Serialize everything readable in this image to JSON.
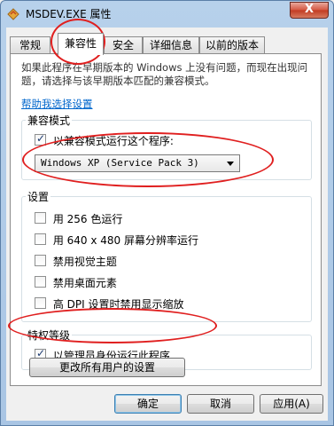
{
  "window": {
    "title": "MSDEV.EXE 属性",
    "close_label": "X"
  },
  "tabs": [
    {
      "label": "常规"
    },
    {
      "label": "兼容性"
    },
    {
      "label": "安全"
    },
    {
      "label": "详细信息"
    },
    {
      "label": "以前的版本"
    }
  ],
  "intro_text": "如果此程序在早期版本的 Windows 上没有问题，而现在出现问题，请选择与该早期版本匹配的兼容模式。",
  "help_link": "帮助我选择设置",
  "compat_mode": {
    "label": "兼容模式",
    "checkbox_label": "以兼容模式运行这个程序:",
    "checked": true,
    "selected_os": "Windows XP (Service Pack 3)"
  },
  "settings": {
    "label": "设置",
    "items": [
      {
        "label": "用 256 色运行",
        "checked": false
      },
      {
        "label": "用 640 x 480 屏幕分辨率运行",
        "checked": false
      },
      {
        "label": "禁用视觉主题",
        "checked": false
      },
      {
        "label": "禁用桌面元素",
        "checked": false
      },
      {
        "label": "高 DPI 设置时禁用显示缩放",
        "checked": false
      }
    ]
  },
  "privilege": {
    "label": "特权等级",
    "checkbox_label": "以管理员身份运行此程序",
    "checked": true
  },
  "all_users_button": "更改所有用户的设置",
  "buttons": {
    "ok": "确定",
    "cancel": "取消",
    "apply": "应用(A)"
  },
  "colors": {
    "annotation_red": "#e01f1f",
    "link_blue": "#0066cc"
  }
}
